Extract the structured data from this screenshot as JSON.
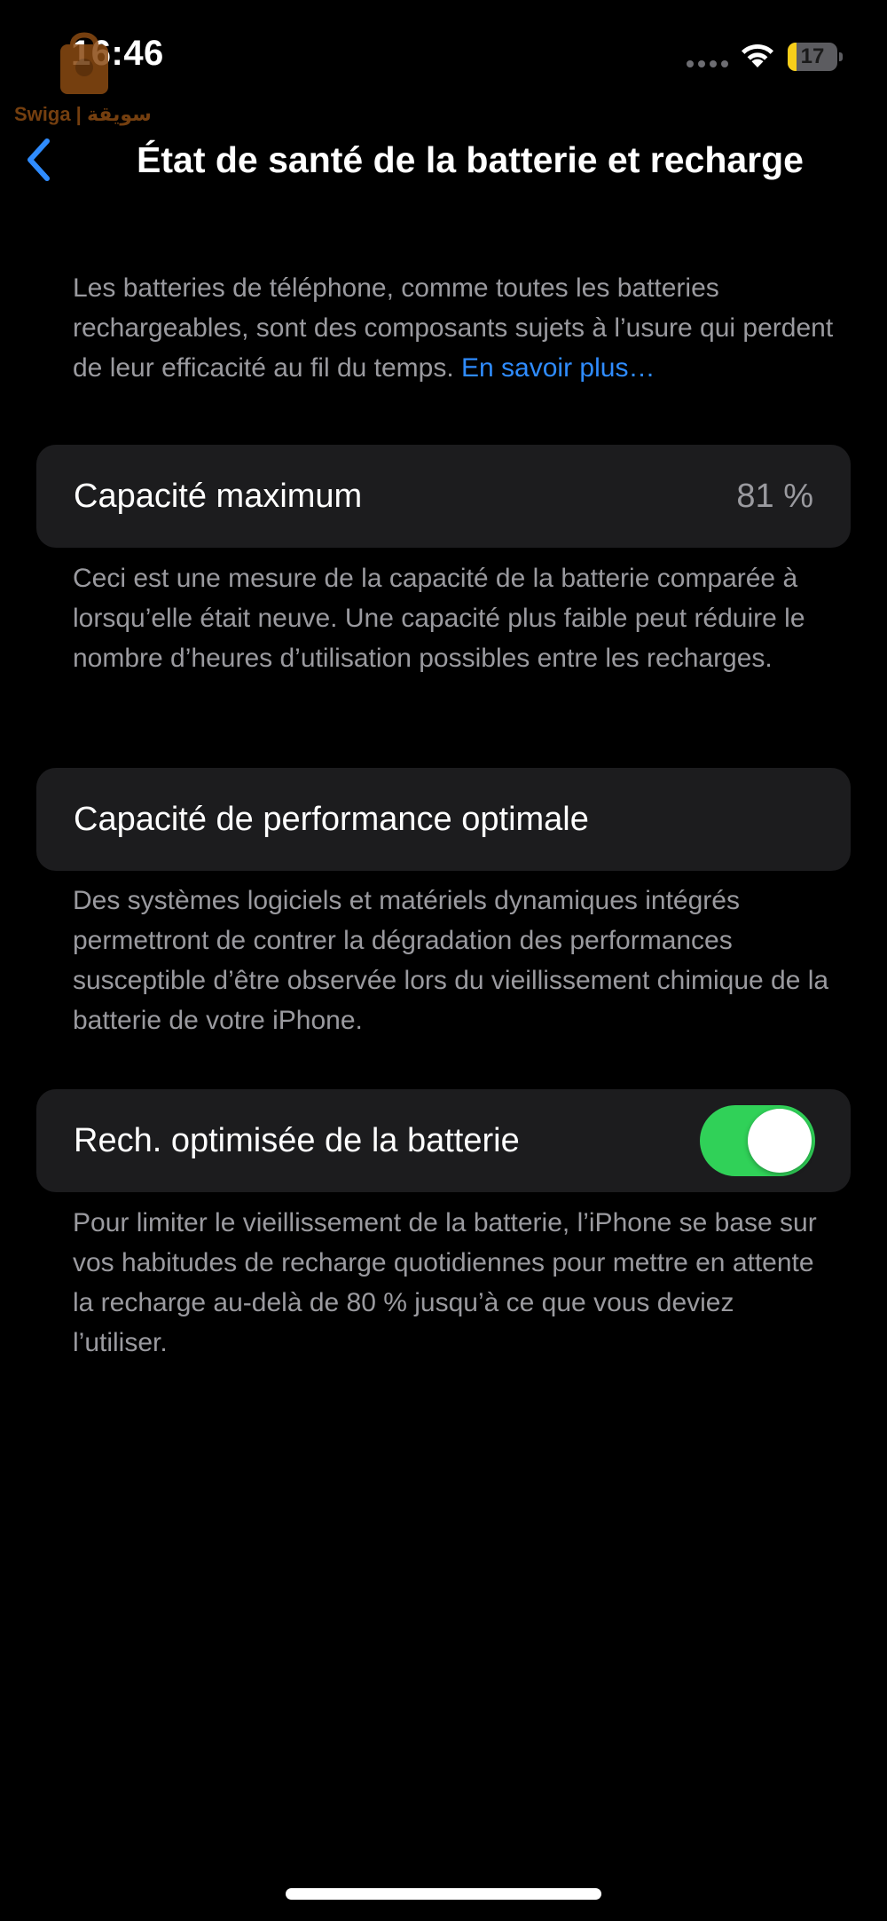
{
  "status_bar": {
    "time": "16:46",
    "battery_level": "17",
    "battery_fraction": 0.17,
    "icons": [
      "signal-dots-icon",
      "wifi-icon",
      "battery-icon"
    ]
  },
  "watermark": {
    "text": "Swiga | سويقة"
  },
  "nav": {
    "back_icon": "chevron-left-icon",
    "title": "État de santé de la batterie et recharge"
  },
  "intro": {
    "text": "Les batteries de téléphone, comme toutes les batteries rechargeables, sont des composants sujets à l’usure qui perdent de leur efficacité au fil du temps. ",
    "link": "En savoir plus…"
  },
  "capacity": {
    "label": "Capacité maximum",
    "value": "81 %",
    "description": "Ceci est une mesure de la capacité de la batterie comparée à lorsqu’elle était neuve. Une capacité plus faible peut réduire le nombre d’heures d’utilisation possibles entre les recharges."
  },
  "performance": {
    "label": "Capacité de performance optimale",
    "description": "Des systèmes logiciels et matériels dynamiques intégrés permettront de contrer la dégradation des performances susceptible d’être observée lors du vieillissement chimique de la batterie de votre iPhone."
  },
  "optimized_charging": {
    "label": "Rech. optimisée de la batterie",
    "enabled": true,
    "description": "Pour limiter le vieillissement de la batterie, l’iPhone se base sur vos habitudes de recharge quotidiennes pour mettre en attente la recharge au-delà de 80 % jusqu’à ce que vous deviez l’utiliser."
  },
  "colors": {
    "background": "#000000",
    "cell": "#1c1c1e",
    "secondary_text": "#9a9a9f",
    "link": "#2f8cff",
    "toggle_on": "#30d158",
    "battery": "#f7ce1a"
  }
}
